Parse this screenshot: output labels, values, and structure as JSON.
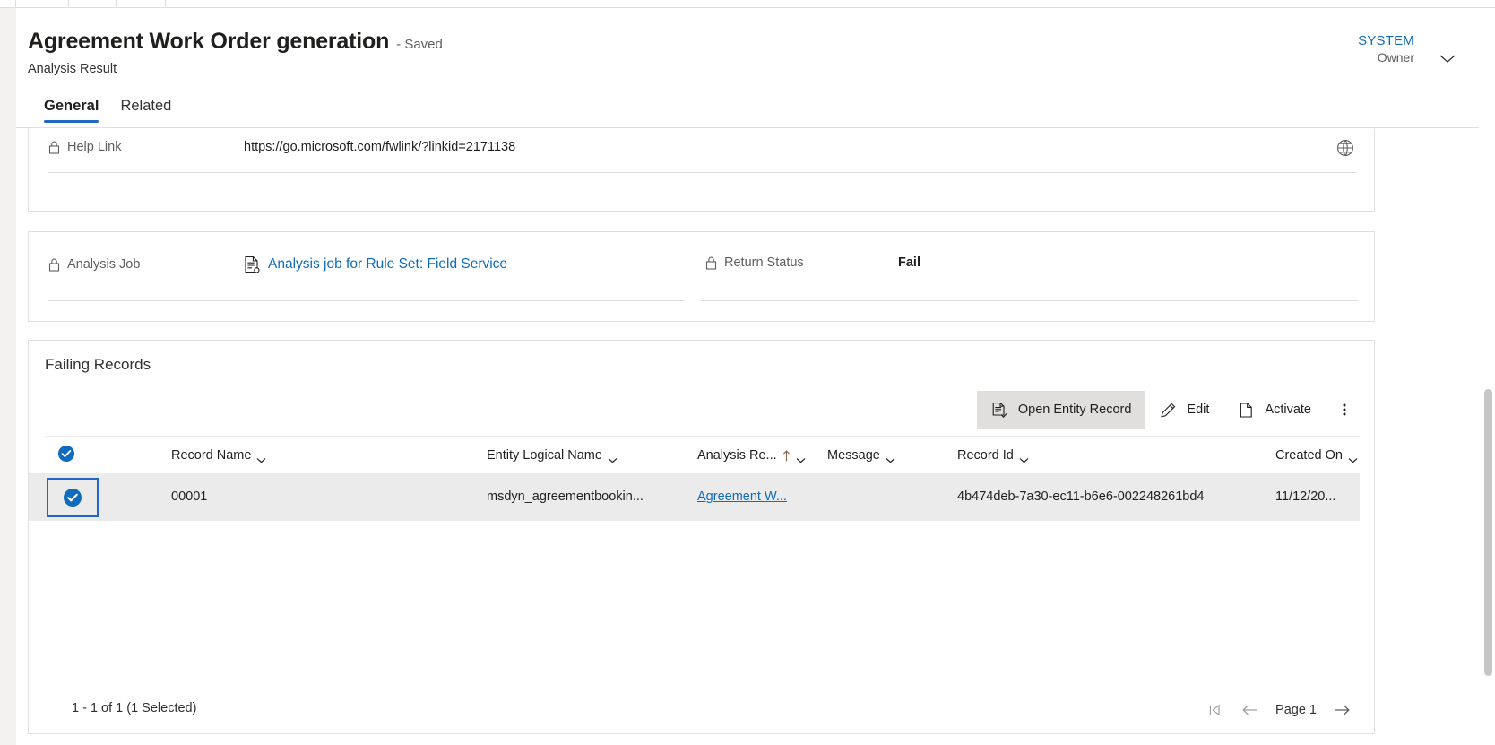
{
  "header": {
    "title": "Agreement Work Order generation",
    "saved_state": "- Saved",
    "subtitle": "Analysis Result",
    "owner_name": "SYSTEM",
    "owner_role": "Owner",
    "chevron_icon": "chevron-down-icon",
    "tabs": [
      {
        "label": "General",
        "active": true
      },
      {
        "label": "Related",
        "active": false
      }
    ]
  },
  "help_section": {
    "label": "Help Link",
    "value": "https://go.microsoft.com/fwlink/?linkid=2171138",
    "lock_icon": "lock-icon",
    "globe_icon": "globe-icon"
  },
  "job_section": {
    "analysis_job_label": "Analysis Job",
    "analysis_job_value": "Analysis job for Rule Set: Field Service",
    "analysis_job_icon": "document-lookup-icon",
    "return_status_label": "Return Status",
    "return_status_value": "Fail",
    "lock_icon": "lock-icon"
  },
  "subgrid": {
    "title": "Failing Records",
    "toolbar": [
      {
        "label": "Open Entity Record",
        "icon": "open-entity-record-icon",
        "selected": true
      },
      {
        "label": "Edit",
        "icon": "pencil-icon",
        "selected": false
      },
      {
        "label": "Activate",
        "icon": "page-icon",
        "selected": false
      }
    ],
    "overflow_label": "⋮",
    "overflow_icon": "more-vertical-icon",
    "select_all_icon": "checkbox-checked-icon",
    "columns": [
      {
        "label": "Record Name",
        "sorted": false
      },
      {
        "label": "Entity Logical Name",
        "sorted": false
      },
      {
        "label": "Analysis Re...",
        "sorted": true,
        "sort_dir": "asc"
      },
      {
        "label": "Message",
        "sorted": false
      },
      {
        "label": "Record Id",
        "sorted": false
      },
      {
        "label": "Created On",
        "sorted": false
      }
    ],
    "rows": [
      {
        "selected": true,
        "record_name": "00001",
        "entity_logical_name": "msdyn_agreementbookin...",
        "analysis_result": "Agreement W...",
        "message": "",
        "record_id": "4b474deb-7a30-ec11-b6e6-002248261bd4",
        "created_on": "11/12/20..."
      }
    ],
    "footer_status": "1 - 1 of 1 (1 Selected)",
    "pager": {
      "first_icon": "first-page-icon",
      "prev_icon": "arrow-left-icon",
      "page_label": "Page 1",
      "next_icon": "arrow-right-icon"
    }
  },
  "colors": {
    "accent": "#0f6cbd",
    "tab_underline": "#2266cc",
    "selection_border": "#2266cc",
    "row_selected_bg": "#ebebeb",
    "toolbar_selected_bg": "#e1dfdd"
  }
}
